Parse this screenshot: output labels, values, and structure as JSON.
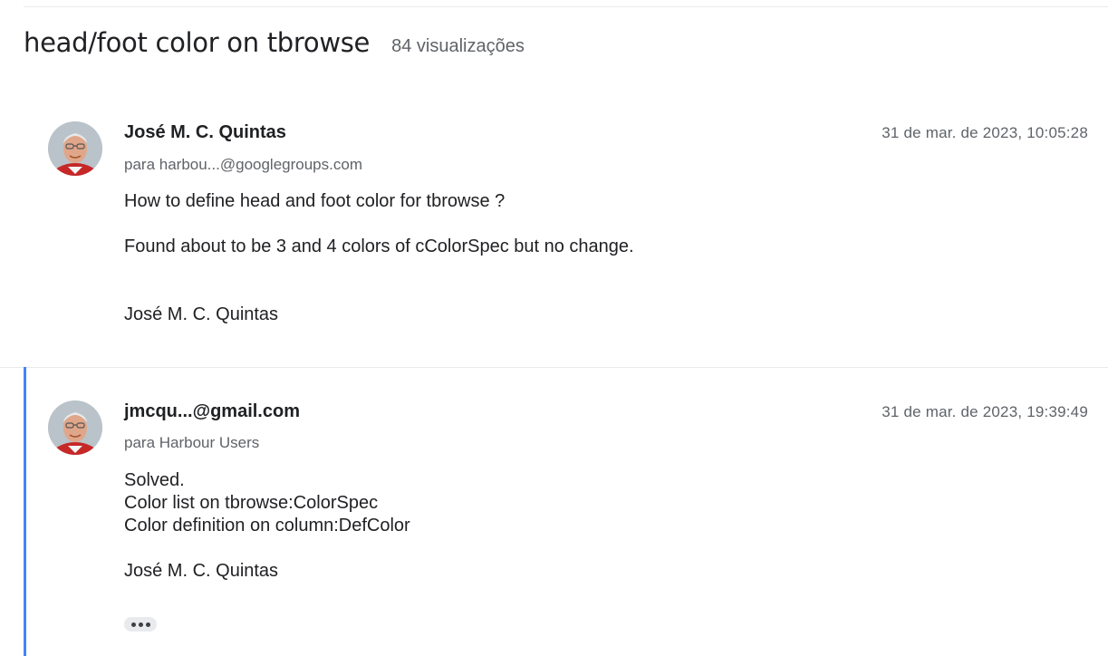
{
  "thread": {
    "title": "head/foot color on tbrowse",
    "views": "84 visualizações"
  },
  "messages": [
    {
      "sender": "José M. C. Quintas",
      "recipient": "para harbou...@googlegroups.com",
      "date": "31 de mar. de 2023, 10:05:28",
      "avatar": "user-photo",
      "body": [
        "How to define head and foot color for tbrowse ?",
        "Found about to be 3 and 4 colors of cColorSpec but no change.",
        "José M. C. Quintas"
      ]
    },
    {
      "sender": "jmcqu...@gmail.com",
      "recipient": "para Harbour Users",
      "date": "31 de mar. de 2023, 19:39:49",
      "avatar": "user-photo",
      "body": [
        "Solved.",
        "Color list on tbrowse:ColorSpec",
        "Color definition on column:DefColor",
        "José M. C. Quintas"
      ],
      "show_trimmed_icon": "more-horiz-icon"
    }
  ],
  "colors": {
    "accent": "#4285f4",
    "text": "#202124",
    "secondary_text": "#5f6368",
    "divider": "#e8eaed"
  }
}
